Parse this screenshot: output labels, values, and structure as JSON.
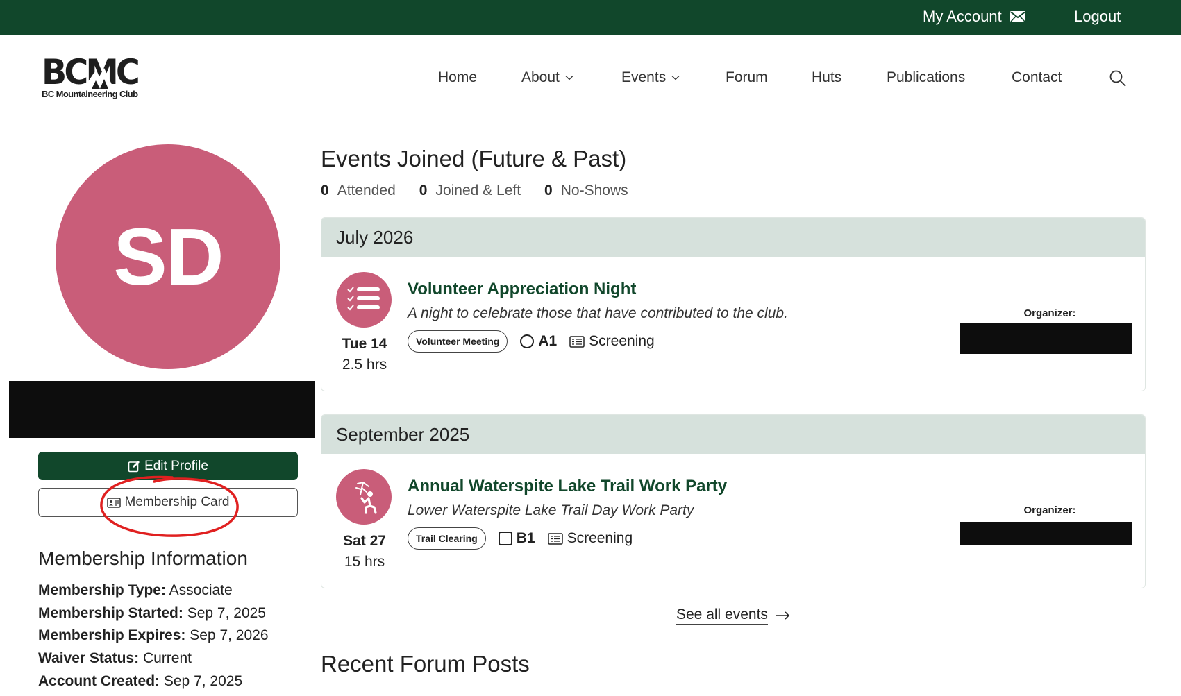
{
  "topbar": {
    "account_label": "My Account",
    "logout_label": "Logout"
  },
  "logo": {
    "mark": "BCMC",
    "subtitle": "BC Mountaineering Club"
  },
  "nav": {
    "items": [
      {
        "label": "Home",
        "dropdown": false
      },
      {
        "label": "About",
        "dropdown": true
      },
      {
        "label": "Events",
        "dropdown": true
      },
      {
        "label": "Forum",
        "dropdown": false
      },
      {
        "label": "Huts",
        "dropdown": false
      },
      {
        "label": "Publications",
        "dropdown": false
      },
      {
        "label": "Contact",
        "dropdown": false
      }
    ]
  },
  "profile": {
    "initials": "SD",
    "avatar_color": "#c95d79",
    "edit_profile_label": "Edit Profile",
    "membership_card_label": "Membership Card"
  },
  "membership": {
    "title": "Membership Information",
    "rows": [
      {
        "label": "Membership Type:",
        "value": "Associate"
      },
      {
        "label": "Membership Started:",
        "value": "Sep 7, 2025"
      },
      {
        "label": "Membership Expires:",
        "value": "Sep 7, 2026"
      },
      {
        "label": "Waiver Status:",
        "value": "Current"
      },
      {
        "label": "Account Created:",
        "value": "Sep 7, 2025"
      }
    ]
  },
  "events": {
    "title": "Events Joined (Future & Past)",
    "stats": [
      {
        "count": "0",
        "label": "Attended"
      },
      {
        "count": "0",
        "label": "Joined & Left"
      },
      {
        "count": "0",
        "label": "No-Shows"
      }
    ],
    "months": [
      {
        "month": "July 2026",
        "event": {
          "title": "Volunteer Appreciation Night",
          "description": "A night to celebrate those that have contributed to the club.",
          "day": "Tue 14",
          "duration": "2.5 hrs",
          "category": "Volunteer Meeting",
          "grade": "A1",
          "screening": "Screening",
          "organizer_label": "Organizer:",
          "icon": "checklist-icon"
        }
      },
      {
        "month": "September 2025",
        "event": {
          "title": "Annual Waterspite Lake Trail Work Party",
          "description": "Lower Waterspite Lake Trail Day Work Party",
          "day": "Sat 27",
          "duration": "15 hrs",
          "category": "Trail Clearing",
          "grade": "B1",
          "screening": "Screening",
          "organizer_label": "Organizer:",
          "icon": "trail-clearing-icon"
        }
      }
    ],
    "see_all_label": "See all events"
  },
  "forum": {
    "title": "Recent Forum Posts"
  },
  "colors": {
    "brand_green": "#11472b",
    "accent_pink": "#c95d79",
    "month_header_bg": "#d6e1dc",
    "annotation_red": "#e02020"
  }
}
